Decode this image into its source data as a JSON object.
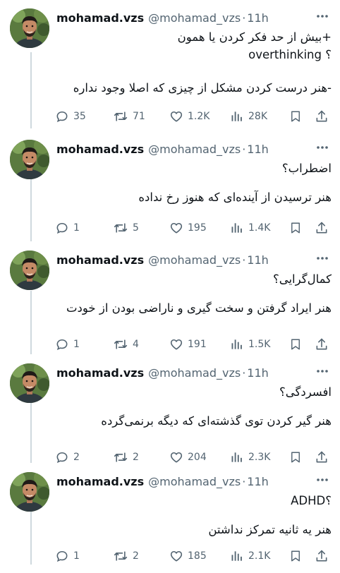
{
  "author": {
    "name": "mohamad.vzs",
    "handle": "@mohamad_vzs",
    "dot": "·",
    "time": "11h"
  },
  "icons": {
    "more": "more-dots-icon",
    "reply": "reply-icon",
    "retweet": "retweet-icon",
    "like": "heart-icon",
    "views": "views-chart-icon",
    "bookmark": "bookmark-icon",
    "share": "share-icon"
  },
  "tweets": [
    {
      "lines": [
        "+بیش از حد فکر کردن یا همون",
        "overthinking ؟",
        "",
        "-هنر درست کردن مشکل از چیزی که اصلا وجود نداره"
      ],
      "replies": "35",
      "retweets": "71",
      "likes": "1.2K",
      "views": "28K"
    },
    {
      "lines": [
        "اضطراب؟",
        "",
        "هنر ترسیدن از آینده‌ای که هنوز رخ نداده"
      ],
      "replies": "1",
      "retweets": "5",
      "likes": "195",
      "views": "1.4K"
    },
    {
      "lines": [
        "کمال‌گرایی؟",
        "",
        "هنر ایراد گرفتن و سخت گیری و ناراضی بودن از خودت"
      ],
      "replies": "1",
      "retweets": "4",
      "likes": "191",
      "views": "1.5K"
    },
    {
      "lines": [
        "افسردگی؟",
        "",
        "هنر گیر کردن توی گذشته‌ای که دیگه برنمی‌گرده"
      ],
      "replies": "2",
      "retweets": "2",
      "likes": "204",
      "views": "2.3K"
    },
    {
      "lines": [
        "ADHD؟",
        "",
        "هنر یه ثانیه تمرکز نداشتن"
      ],
      "replies": "1",
      "retweets": "2",
      "likes": "185",
      "views": "2.1K"
    }
  ]
}
